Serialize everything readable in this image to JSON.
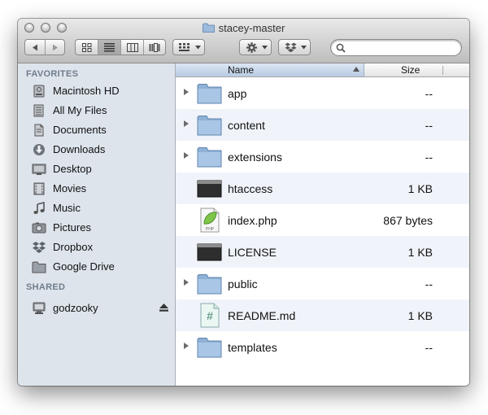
{
  "window": {
    "title": "stacey-master"
  },
  "search": {
    "value": "",
    "placeholder": ""
  },
  "sidebar": {
    "favorites_heading": "FAVORITES",
    "shared_heading": "SHARED",
    "favorites": [
      {
        "label": "Macintosh HD",
        "icon": "hard-drive-icon"
      },
      {
        "label": "All My Files",
        "icon": "all-files-icon"
      },
      {
        "label": "Documents",
        "icon": "documents-icon"
      },
      {
        "label": "Downloads",
        "icon": "downloads-icon"
      },
      {
        "label": "Desktop",
        "icon": "desktop-icon"
      },
      {
        "label": "Movies",
        "icon": "movies-icon"
      },
      {
        "label": "Music",
        "icon": "music-icon"
      },
      {
        "label": "Pictures",
        "icon": "pictures-icon"
      },
      {
        "label": "Dropbox",
        "icon": "dropbox-icon"
      },
      {
        "label": "Google Drive",
        "icon": "folder-icon"
      }
    ],
    "shared": [
      {
        "label": "godzooky",
        "icon": "computer-icon"
      }
    ]
  },
  "list": {
    "columns": {
      "name": "Name",
      "size": "Size"
    },
    "rows": [
      {
        "name": "app",
        "size": "--",
        "kind": "folder"
      },
      {
        "name": "content",
        "size": "--",
        "kind": "folder"
      },
      {
        "name": "extensions",
        "size": "--",
        "kind": "folder"
      },
      {
        "name": "htaccess",
        "size": "1 KB",
        "kind": "exec"
      },
      {
        "name": "index.php",
        "size": "867 bytes",
        "kind": "php"
      },
      {
        "name": "LICENSE",
        "size": "1 KB",
        "kind": "exec"
      },
      {
        "name": "public",
        "size": "--",
        "kind": "folder"
      },
      {
        "name": "README.md",
        "size": "1 KB",
        "kind": "md"
      },
      {
        "name": "templates",
        "size": "--",
        "kind": "folder"
      }
    ]
  },
  "colors": {
    "sidebar_bg": "#dde4ec",
    "row_alt": "#f0f4fa",
    "folder": "#8fb1d6"
  }
}
